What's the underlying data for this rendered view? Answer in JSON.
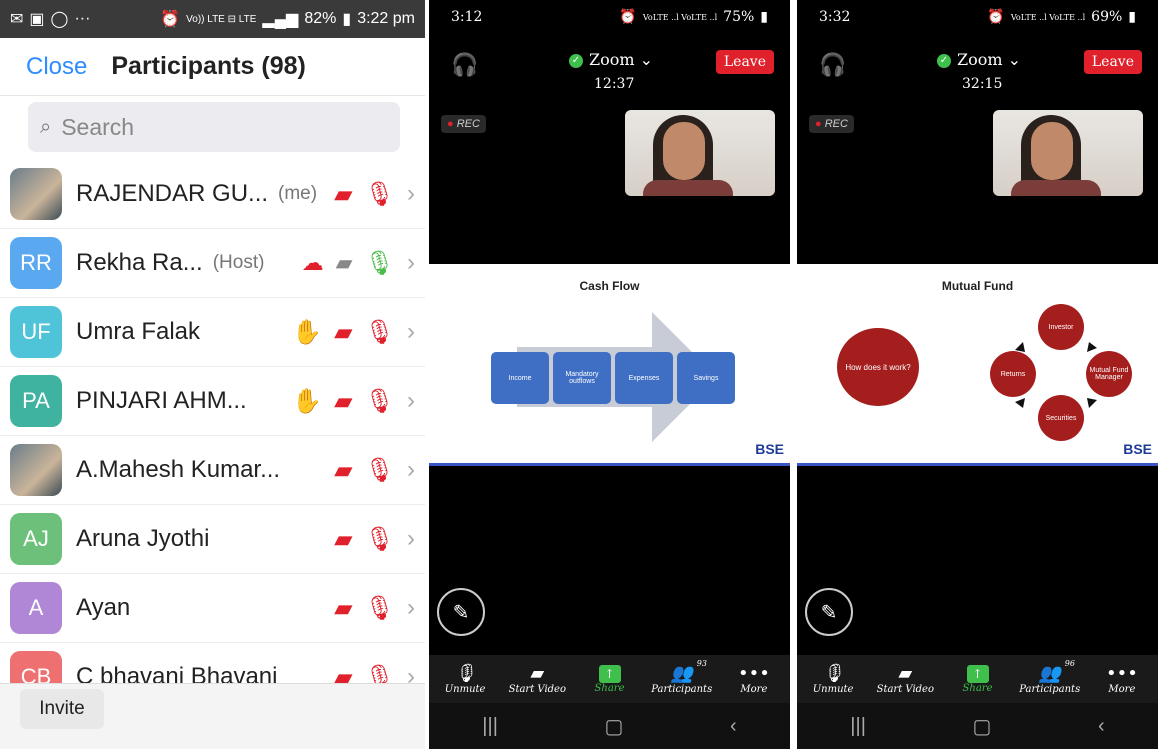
{
  "left_phone": {
    "status_time": "3:22 pm",
    "status_battery": "82%",
    "status_indicators": "Vo)) LTE ⊟ LTE",
    "close_label": "Close",
    "title": "Participants (98)",
    "search_placeholder": "Search",
    "participants": [
      {
        "initials": "",
        "name": "RAJENDAR GU...",
        "tag": "(me)",
        "color": "#7a8a96",
        "photo": true,
        "hand": false,
        "cloud": false,
        "video_on": false,
        "mic_on": false
      },
      {
        "initials": "RR",
        "name": "Rekha Ra...",
        "tag": "(Host)",
        "color": "#5aa9f0",
        "photo": false,
        "hand": false,
        "cloud": true,
        "video_on": true,
        "mic_on": true
      },
      {
        "initials": "UF",
        "name": "Umra Falak",
        "tag": "",
        "color": "#4fc3d8",
        "photo": false,
        "hand": true,
        "cloud": false,
        "video_on": false,
        "mic_on": false
      },
      {
        "initials": "PA",
        "name": "PINJARI AHM...",
        "tag": "",
        "color": "#3fb3a0",
        "photo": false,
        "hand": true,
        "cloud": false,
        "video_on": false,
        "mic_on": false
      },
      {
        "initials": "",
        "name": "A.Mahesh Kumar...",
        "tag": "",
        "color": "#7a8a96",
        "photo": true,
        "hand": false,
        "cloud": false,
        "video_on": false,
        "mic_on": false
      },
      {
        "initials": "AJ",
        "name": "Aruna Jyothi",
        "tag": "",
        "color": "#6cc07a",
        "photo": false,
        "hand": false,
        "cloud": false,
        "video_on": false,
        "mic_on": false
      },
      {
        "initials": "A",
        "name": "Ayan",
        "tag": "",
        "color": "#b086d6",
        "photo": false,
        "hand": false,
        "cloud": false,
        "video_on": false,
        "mic_on": false
      },
      {
        "initials": "CB",
        "name": "C bhavani Bhavani",
        "tag": "",
        "color": "#ee7070",
        "photo": false,
        "hand": false,
        "cloud": false,
        "video_on": false,
        "mic_on": false
      }
    ],
    "invite_label": "Invite"
  },
  "middle_phone": {
    "status_time": "3:12",
    "status_battery": "75%",
    "status_indicators": "VoLTE ..l VoLTE ..l",
    "app_label": "Zoom",
    "timer": "12:37",
    "leave_label": "Leave",
    "rec_label": "REC",
    "slide_title": "Cash Flow",
    "slide_boxes": [
      "Income",
      "Mandatory outflows",
      "Expenses",
      "Savings"
    ],
    "slide_logo": "BSE",
    "toolbar": [
      "Unmute",
      "Start Video",
      "Share",
      "Participants",
      "More"
    ],
    "participants_count": "93"
  },
  "right_phone": {
    "status_time": "3:32",
    "status_battery": "69%",
    "status_indicators": "VoLTE ..l VoLTE ..l",
    "app_label": "Zoom",
    "timer": "32:15",
    "leave_label": "Leave",
    "rec_label": "REC",
    "slide_title": "Mutual Fund",
    "slide_center": "How does it work?",
    "slide_cycle": [
      "Investor",
      "Mutual Fund Manager",
      "Securities",
      "Returns"
    ],
    "slide_logo": "BSE",
    "toolbar": [
      "Unmute",
      "Start Video",
      "Share",
      "Participants",
      "More"
    ],
    "participants_count": "96"
  },
  "colors": {
    "accent": "#2d8cff",
    "red": "#e0202a",
    "green": "#3fbf4c",
    "slide_blue": "#3e6fc4",
    "slide_red": "#a51e1e"
  }
}
